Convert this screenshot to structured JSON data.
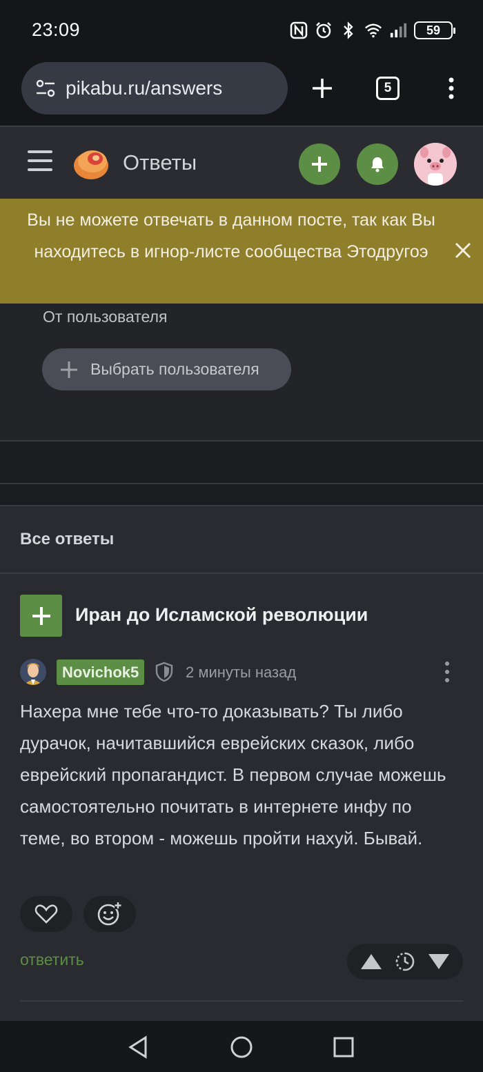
{
  "status_bar": {
    "time": "23:09",
    "battery": "59",
    "icons": [
      "nfc-icon",
      "alarm-icon",
      "bluetooth-icon",
      "wifi-icon",
      "signal-icon",
      "battery-icon"
    ]
  },
  "browser": {
    "url": "pikabu.ru/answers",
    "tabs_count": "5",
    "icons": [
      "site-settings-icon",
      "new-tab-icon",
      "tab-switcher-icon",
      "more-vert-icon"
    ]
  },
  "app_header": {
    "title": "Ответы",
    "icons": [
      "menu-icon",
      "pikabu-logo",
      "add-post-icon",
      "bell-icon",
      "user-avatar"
    ]
  },
  "banner": {
    "text": "Вы не можете отвечать в данном посте, так как Вы находитесь в игнор-листе сообщества Этодругоэ",
    "close_icon": "close-icon"
  },
  "filter": {
    "label": "От пользователя",
    "button_label": "Выбрать пользователя"
  },
  "answers": {
    "section_title": "Все ответы",
    "post_title": "Иран до Исламской революции",
    "author": "Novichok5",
    "time_ago": "2 минуты назад",
    "comment_text": "Нахера мне тебе что-то доказывать? Ты либо дурачок, начитавшийся еврейских сказок, либо еврейский пропагандист. В первом случае можешь самостоятельно почитать в интернете инфу по теме, во втором - можешь пройти нахуй. Бывай.",
    "reply_label": "ответить"
  },
  "colors": {
    "accent_green": "#5d8e45",
    "banner_bg": "#8f7f2a",
    "page_bg": "#1e1f22"
  }
}
